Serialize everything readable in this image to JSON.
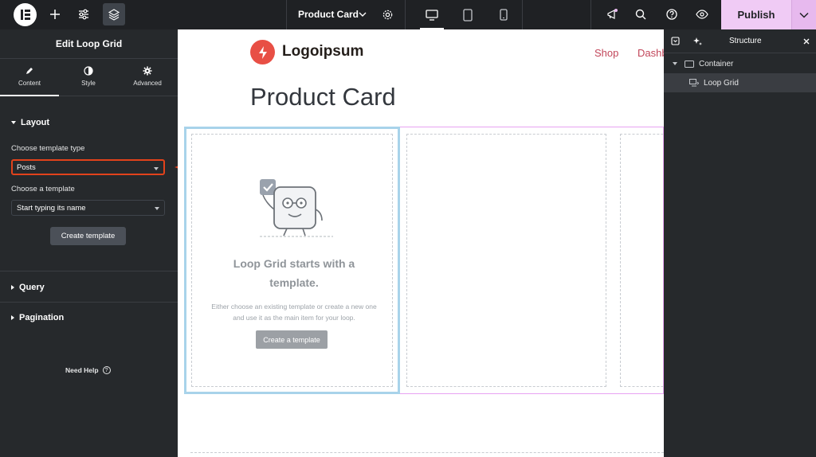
{
  "topbar": {
    "logo_icon": "elementor-logo-icon",
    "add_icon": "plus-icon",
    "settings_icon": "sliders-icon",
    "structure_icon": "layers-icon",
    "page_title": "Product Card",
    "publish_label": "Publish",
    "accent_color": "#f0cbf5"
  },
  "left_panel": {
    "title": "Edit Loop Grid",
    "tabs": [
      {
        "label": "Content",
        "icon": "pencil-icon",
        "selected": true
      },
      {
        "label": "Style",
        "icon": "contrast-icon",
        "selected": false
      },
      {
        "label": "Advanced",
        "icon": "gear-icon",
        "selected": false
      }
    ],
    "layout": {
      "section_label": "Layout",
      "template_type_label": "Choose template type",
      "template_type_value": "Posts",
      "template_label": "Choose a template",
      "template_placeholder": "Start typing its name",
      "create_button": "Create template"
    },
    "query_label": "Query",
    "pagination_label": "Pagination",
    "help_label": "Need Help",
    "highlight_color": "#e2421b"
  },
  "canvas": {
    "logo_text": "Logoipsum",
    "nav": [
      "Shop",
      "Dashb"
    ],
    "page_title": "Product Card",
    "empty_state": {
      "title_line1": "Loop Grid starts with a",
      "title_line2": "template.",
      "desc_line1": "Either choose an existing template or create a new one",
      "desc_line2": "and use it as the main item for your loop.",
      "button": "Create a template"
    }
  },
  "structure_panel": {
    "title": "Structure",
    "items": [
      {
        "label": "Container",
        "icon": "container-icon",
        "expanded": true
      },
      {
        "label": "Loop Grid",
        "icon": "loop-grid-icon",
        "active": true
      }
    ]
  }
}
